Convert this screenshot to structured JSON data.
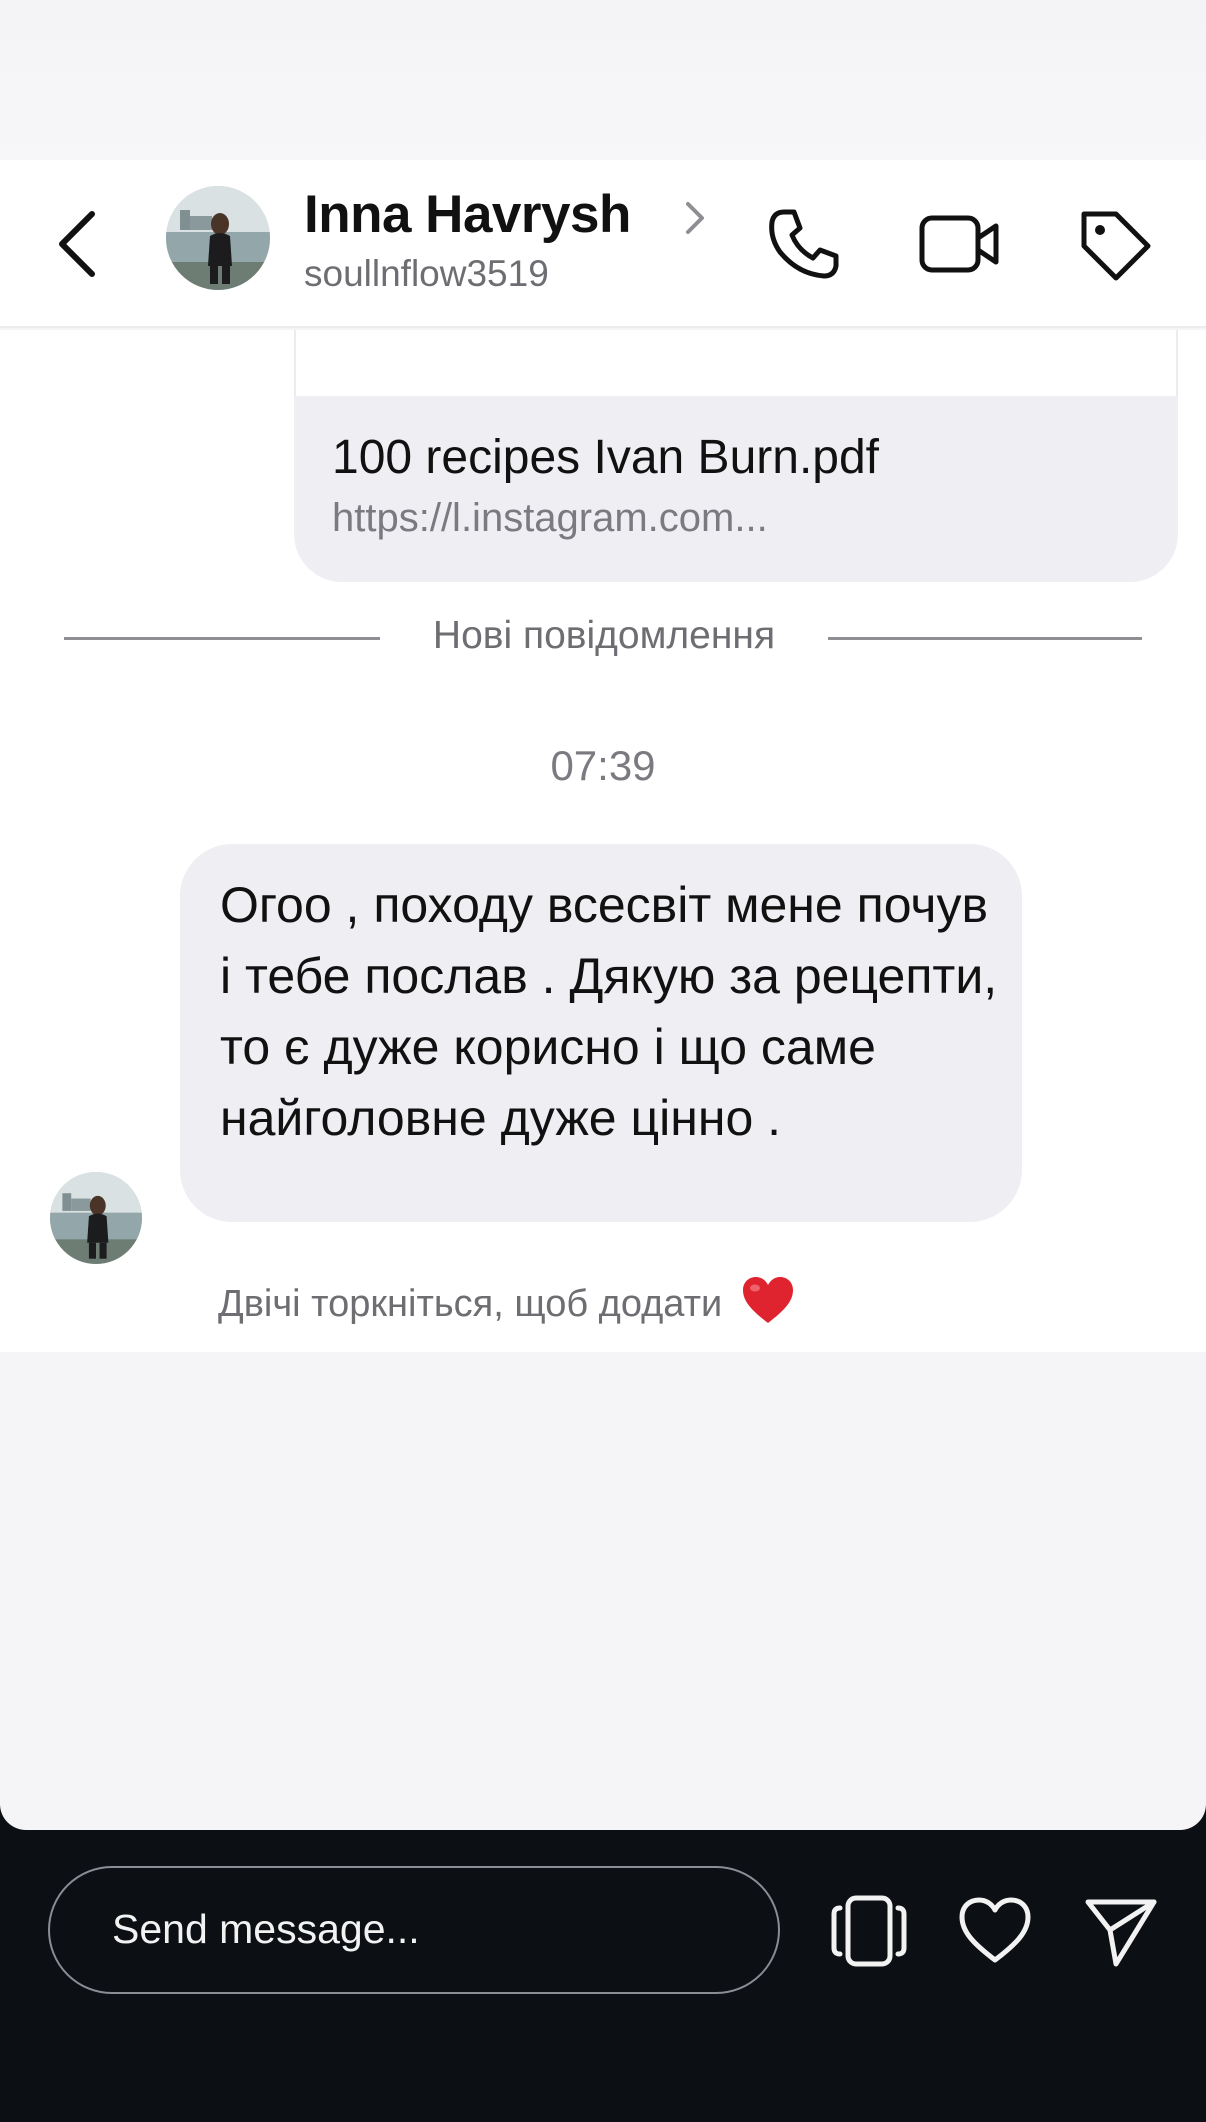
{
  "header": {
    "contact_name": "Inna Havrysh",
    "username": "soullnflow3519"
  },
  "chat": {
    "link_message": {
      "title": "100 recipes Ivan Burn.pdf",
      "url": "https://l.instagram.com..."
    },
    "new_messages_divider": "Нові повідомлення",
    "timestamp": "07:39",
    "incoming_message": "Огоо , походу всесвіт мене почув і тебе послав . Дякую за рецепти, то є дуже корисно і що саме найголовне дуже цінно .",
    "reaction_hint": "Двічі торкніться, щоб додати"
  },
  "composer": {
    "placeholder": "Send message..."
  },
  "icons": {
    "back": "chevron-left-icon",
    "profile": "chevron-right-icon",
    "call": "phone-icon",
    "video": "video-camera-icon",
    "tag": "tag-icon",
    "reaction": "red-heart-icon",
    "stack": "card-stack-icon",
    "like": "heart-icon",
    "send": "paper-plane-icon"
  },
  "colors": {
    "bubble": "#efeff3",
    "chat_background": "#ffffff",
    "bottom_bar": "#0c0f14",
    "heart": "#e0242f"
  }
}
